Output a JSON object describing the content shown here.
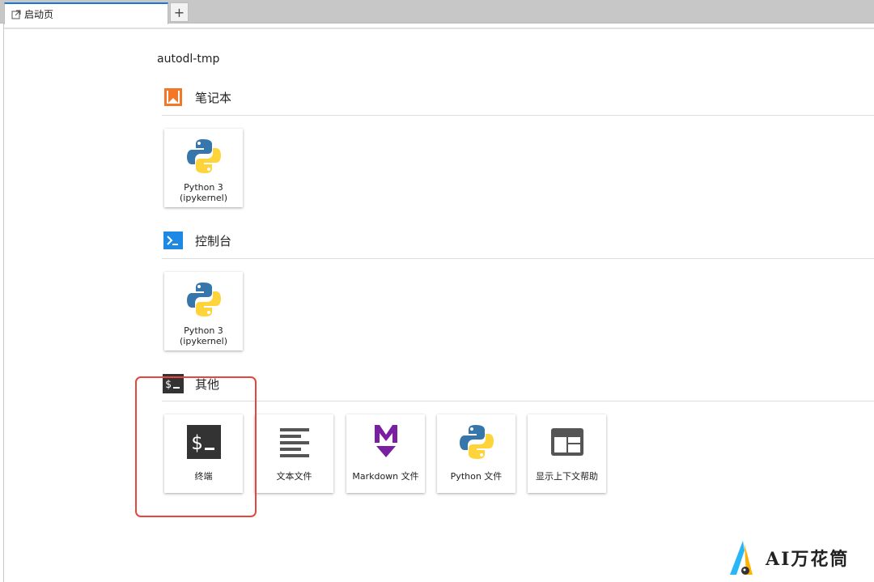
{
  "tabs": [
    {
      "label": "启动页"
    }
  ],
  "add_tab_label": "+",
  "cwd": "autodl-tmp",
  "sections": {
    "notebook": {
      "title": "笔记本",
      "cards": [
        {
          "line1": "Python 3",
          "line2": "(ipykernel)"
        }
      ]
    },
    "console": {
      "title": "控制台",
      "cards": [
        {
          "line1": "Python 3",
          "line2": "(ipykernel)"
        }
      ]
    },
    "other": {
      "title": "其他",
      "cards": [
        {
          "label": "终端",
          "icon": "terminal-icon"
        },
        {
          "label": "文本文件",
          "icon": "text-file-icon"
        },
        {
          "label": "Markdown 文件",
          "icon": "markdown-icon"
        },
        {
          "label": "Python 文件",
          "icon": "python-icon"
        },
        {
          "label": "显示上下文帮助",
          "icon": "context-help-icon"
        }
      ]
    }
  },
  "watermark": {
    "text": "AI万花筒"
  },
  "colors": {
    "tab_accent": "#1976d2",
    "notebook_icon": "#f37726",
    "console_icon": "#1e88e5",
    "highlight": "#e8453c",
    "markdown": "#7b1fa2"
  }
}
